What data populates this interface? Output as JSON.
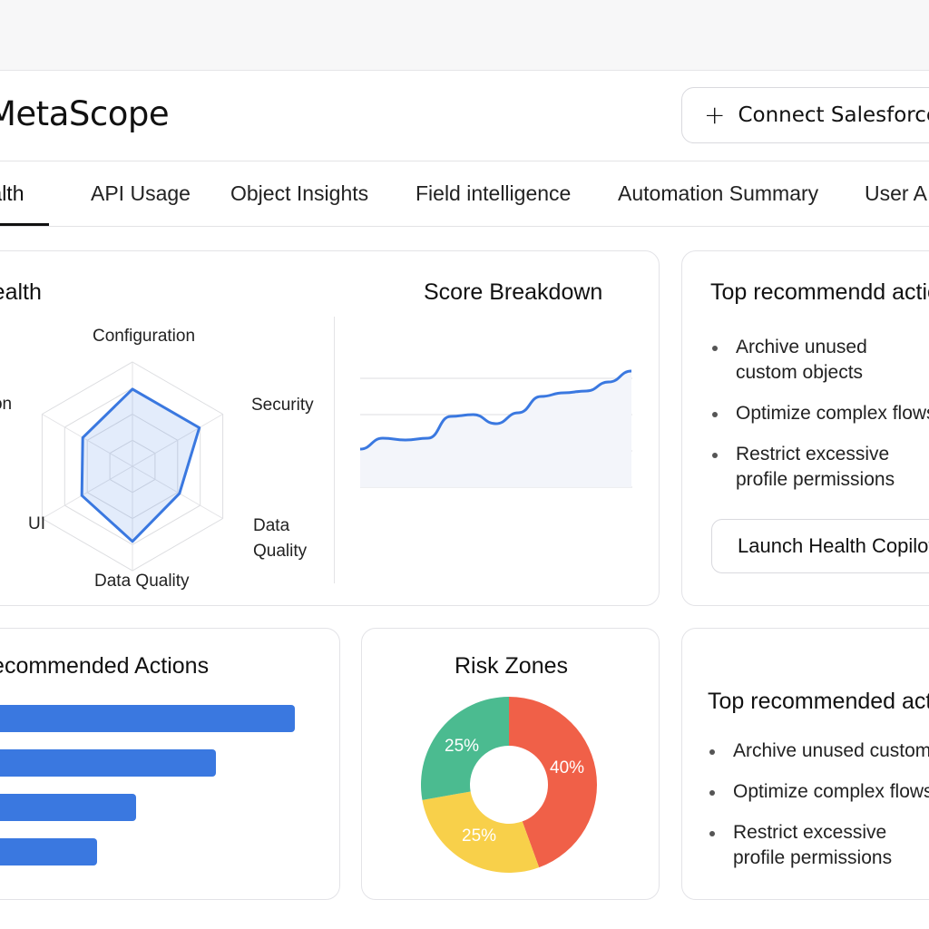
{
  "app": {
    "title": "MetaScope",
    "connect_label": "Connect Salesforce",
    "connect_icon": "plus-icon"
  },
  "tabs": [
    {
      "label": "Health",
      "active": true
    },
    {
      "label": "API Usage",
      "active": false
    },
    {
      "label": "Object Insights",
      "active": false
    },
    {
      "label": "Field intelligence",
      "active": false
    },
    {
      "label": "Automation Summary",
      "active": false
    },
    {
      "label": "User A",
      "active": false
    }
  ],
  "health_card": {
    "title": "Org Health",
    "radar_labels": {
      "top": "Configuration",
      "right": "Security",
      "bottom_right": "Data Quality",
      "bottom": "Data Quality",
      "left_bottom": "UI",
      "left_top": "Automation"
    },
    "breakdown_title": "Score Breakdown"
  },
  "recommend_card_top": {
    "title": "Top recommendd actions",
    "items": [
      "Archive unused custom objects",
      "Optimize complex flows",
      "Restrict excessive profile permissions"
    ],
    "button_label": "Launch Health Copilot"
  },
  "actions_card": {
    "title": "Recommended Actions"
  },
  "risk_card": {
    "title": "Risk Zones"
  },
  "recommend_card_bottom": {
    "title": "Top recommended actions",
    "items": [
      "Archive unused custom objects",
      "Optimize complex flows",
      "Restrict excessive profile permissions"
    ]
  },
  "chart_data": [
    {
      "type": "radar",
      "axes": [
        "Configuration",
        "Security",
        "Data Quality",
        "Data Quality",
        "UI",
        "Automation"
      ],
      "values": [
        0.74,
        0.74,
        0.52,
        0.72,
        0.56,
        0.55
      ],
      "max": 1
    },
    {
      "type": "area",
      "title": "Score Breakdown",
      "x": [
        0,
        1,
        2,
        3,
        4,
        5,
        6,
        7,
        8,
        9,
        10,
        11,
        12
      ],
      "values": [
        2.05,
        2.35,
        2.3,
        2.35,
        2.95,
        3.0,
        2.75,
        3.05,
        3.5,
        3.6,
        3.65,
        3.9,
        4.2
      ],
      "ylim": [
        0,
        5
      ],
      "grid": true,
      "color": "#3a78e0"
    },
    {
      "type": "bar",
      "orientation": "horizontal",
      "title": "Recommended Actions",
      "values": [
        352,
        268,
        183,
        141
      ],
      "xlim": [
        0,
        360
      ],
      "color": "#3a78e0"
    },
    {
      "type": "pie",
      "title": "Risk Zones",
      "donut": true,
      "slices": [
        {
          "label": "40%",
          "value": 40,
          "color": "#f06048"
        },
        {
          "label": "25%",
          "value": 25,
          "color": "#f8d04a"
        },
        {
          "label": "25%",
          "value": 25,
          "color": "#4bbb90"
        }
      ]
    }
  ]
}
